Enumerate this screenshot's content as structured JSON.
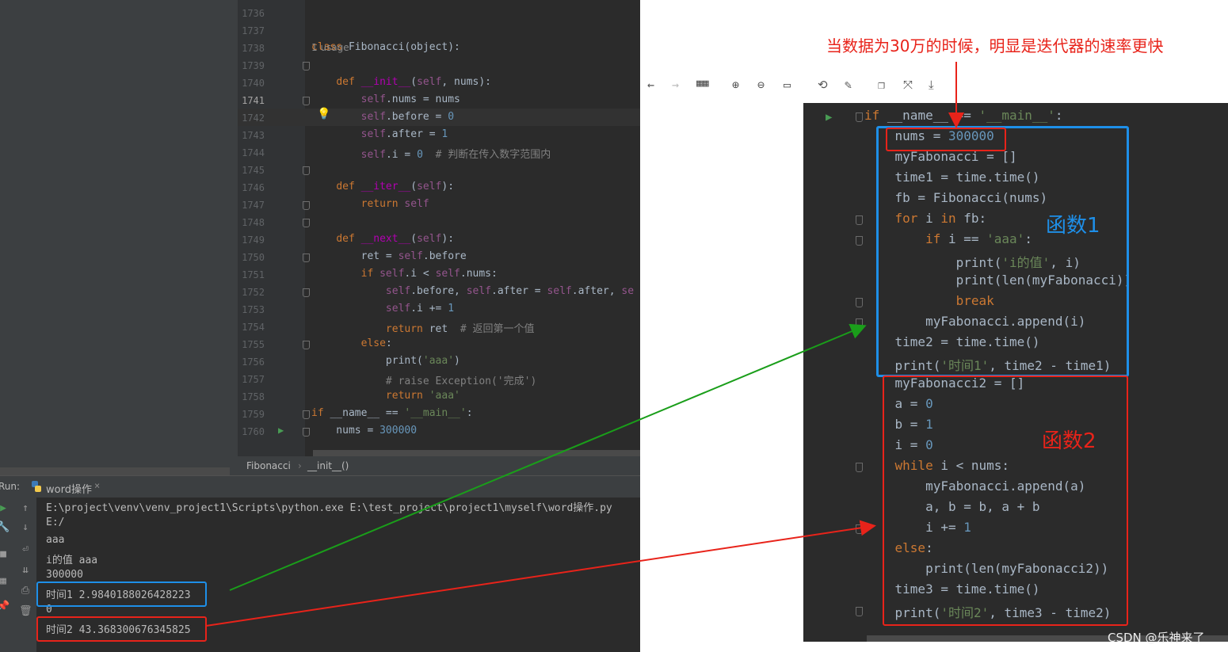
{
  "editor": {
    "usage_hint": "1 usage",
    "lines": [
      {
        "n": "1736",
        "html": ""
      },
      {
        "n": "1737",
        "html": ""
      },
      {
        "n": "1738",
        "html": "<span class=\"kw\">class </span>Fibonacci(object):"
      },
      {
        "n": "1739",
        "html": ""
      },
      {
        "n": "1740",
        "html": "    <span class=\"kw\">def </span><span class=\"mg\">__init__</span>(<span class=\"sf\">self</span>, nums):"
      },
      {
        "n": "1741",
        "html": "        <span class=\"sf\">self</span>.nums = nums"
      },
      {
        "n": "1742",
        "html": "        <span class=\"sf\">self</span>.before = <span class=\"num\">0</span>"
      },
      {
        "n": "1743",
        "html": "        <span class=\"sf\">self</span>.after = <span class=\"num\">1</span>"
      },
      {
        "n": "1744",
        "html": "        <span class=\"sf\">self</span>.i = <span class=\"num\">0</span>  <span class=\"cm\"># 判断在传入数字范围内</span>"
      },
      {
        "n": "1745",
        "html": ""
      },
      {
        "n": "1746",
        "html": "    <span class=\"kw\">def </span><span class=\"mg\">__iter__</span>(<span class=\"sf\">self</span>):"
      },
      {
        "n": "1747",
        "html": "        <span class=\"kw\">return </span><span class=\"sf\">self</span>"
      },
      {
        "n": "1748",
        "html": ""
      },
      {
        "n": "1749",
        "html": "    <span class=\"kw\">def </span><span class=\"mg\">__next__</span>(<span class=\"sf\">self</span>):"
      },
      {
        "n": "1750",
        "html": "        ret = <span class=\"sf\">self</span>.before"
      },
      {
        "n": "1751",
        "html": "        <span class=\"kw\">if </span><span class=\"sf\">self</span>.i < <span class=\"sf\">self</span>.nums:"
      },
      {
        "n": "1752",
        "html": "            <span class=\"sf\">self</span>.before, <span class=\"sf\">self</span>.after = <span class=\"sf\">self</span>.after, <span class=\"sf\">se</span>"
      },
      {
        "n": "1753",
        "html": "            <span class=\"sf\">self</span>.i += <span class=\"num\">1</span>"
      },
      {
        "n": "1754",
        "html": "            <span class=\"kw\">return </span>ret  <span class=\"cm\"># 返回第一个值</span>"
      },
      {
        "n": "1755",
        "html": "        <span class=\"kw\">else</span>:"
      },
      {
        "n": "1756",
        "html": "            print(<span class=\"str\">'aaa'</span>)"
      },
      {
        "n": "1757",
        "html": "            <span class=\"cm\"># raise Exception('完成')</span>"
      },
      {
        "n": "1758",
        "html": "            <span class=\"kw\">return </span><span class=\"str\">'aaa'</span>"
      },
      {
        "n": "1759",
        "html": "<span class=\"kw\">if </span>__name__ == <span class=\"str\">'__main__'</span>:"
      },
      {
        "n": "1760",
        "html": "    nums = <span class=\"num\">300000</span>"
      }
    ]
  },
  "breadcrumb": {
    "item1": "Fibonacci",
    "item2": "__init__()"
  },
  "run": {
    "label": "Run:",
    "tab": "word操作",
    "output": [
      "E:\\project\\venv\\venv_project1\\Scripts\\python.exe E:\\test_project\\project1\\myself\\word操作.py",
      "E:/",
      "aaa",
      "i的值 aaa",
      "300000",
      "时间1 2.9840188026428223",
      "0",
      "时间2 43.368300676345825"
    ]
  },
  "viewer": {
    "lines": [
      "<span class=\"kw\">if </span>__name__ == <span class=\"str\">'__main__'</span>:",
      "    nums = <span class=\"num\">300000</span>",
      "    myFabonacci = []",
      "    time1 = time.time()",
      "    fb = Fibonacci(nums)",
      "    <span class=\"kw\">for </span>i <span class=\"kw\">in </span>fb:",
      "        <span class=\"kw\">if </span>i == <span class=\"str\">'aaa'</span>:",
      "            print(<span class=\"str\">'i的值'</span>, i)",
      "            print(len(myFabonacci))",
      "            <span class=\"kw\">break</span>",
      "        myFabonacci.append(i)",
      "    time2 = time.time()",
      "    print(<span class=\"str\">'时间1'</span>, time2 - time1)",
      "    myFabonacci2 = []",
      "    a = <span class=\"num\">0</span>",
      "    b = <span class=\"num\">1</span>",
      "    i = <span class=\"num\">0</span>",
      "    <span class=\"kw\">while </span>i < nums:",
      "        myFabonacci.append(a)",
      "        a, b = b, a + b",
      "        i += <span class=\"num\">1</span>",
      "    <span class=\"kw\">else</span>:",
      "        print(len(myFabonacci2))",
      "    time3 = time.time()",
      "    print(<span class=\"str\">'时间2'</span>, time3 - time2)"
    ]
  },
  "annotations": {
    "headline": "当数据为30万的时候，明显是迭代器的速率更快",
    "label1": "函数1",
    "label2": "函数2",
    "watermark": "CSDN @乐神来了",
    "colors": {
      "red": "#e8231a",
      "blue": "#1e8fe8",
      "green": "#1a9e1a"
    }
  }
}
